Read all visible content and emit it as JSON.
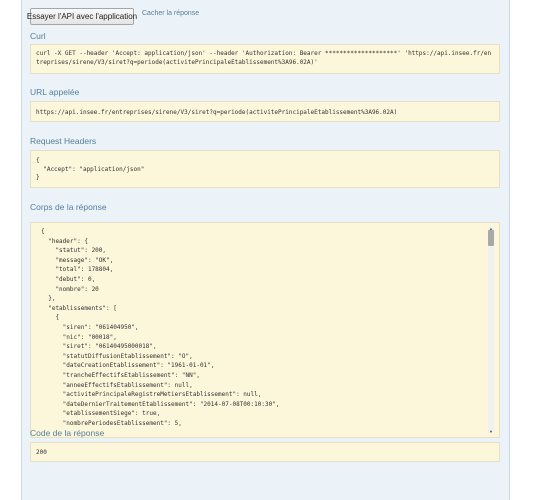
{
  "try_button": "Essayer l'API avec l'application",
  "hide_link": "Cacher la réponse",
  "curl": {
    "title": "Curl",
    "lines": [
      "curl -X GET --header 'Accept: application/json' --header 'Authorization: Bearer ********************' 'https://api.insee.fr/en",
      "treprises/sirene/V3/siret?q=periode(activitePrincipaleEtablissement%3A96.02A)'"
    ]
  },
  "url": {
    "title": "URL appelée",
    "value": "https://api.insee.fr/entreprises/sirene/V3/siret?q=periode(activitePrincipaleEtablissement%3A96.02A)"
  },
  "request_headers": {
    "title": "Request Headers",
    "lines": [
      "{",
      "  \"Accept\": \"application/json\"",
      "}"
    ]
  },
  "response_body": {
    "title": "Corps de la réponse",
    "lines": [
      "{",
      "  \"header\": {",
      "    \"statut\": 200,",
      "    \"message\": \"OK\",",
      "    \"total\": 178804,",
      "    \"debut\": 0,",
      "    \"nombre\": 20",
      "  },",
      "  \"etablissements\": [",
      "    {",
      "      \"siren\": \"061404950\",",
      "      \"nic\": \"00018\",",
      "      \"siret\": \"06140495000018\",",
      "      \"statutDiffusionEtablissement\": \"O\",",
      "      \"dateCreationEtablissement\": \"1961-01-01\",",
      "      \"trancheEffectifsEtablissement\": \"NN\",",
      "      \"anneeEffectifsEtablissement\": null,",
      "      \"activitePrincipaleRegistreMetiersEtablissement\": null,",
      "      \"dateDernierTraitementEtablissement\": \"2014-07-08T00:10:30\",",
      "      \"etablissementSiege\": true,",
      "      \"nombrePeriodesEtablissement\": 5,"
    ]
  },
  "response_code": {
    "title": "Code de la réponse",
    "value": "200"
  },
  "colors": {
    "panel_bg": "#ebf3f9",
    "code_bg": "#fcf6db",
    "heading": "#547f9c"
  }
}
